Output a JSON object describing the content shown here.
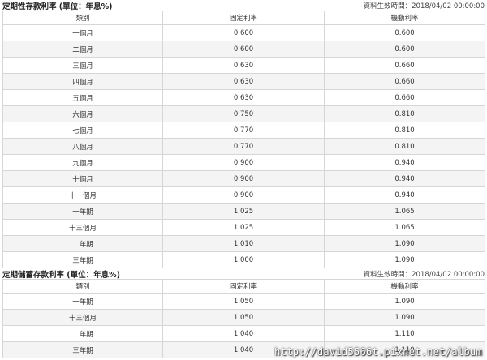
{
  "fixed_deposit": {
    "title": "定期性存款利率 (單位：年息%)",
    "effective_time": "資料生效時間：2018/04/02 00:00:00",
    "headers": [
      "類別",
      "固定利率",
      "機動利率"
    ],
    "rows": [
      [
        "一個月",
        "0.600",
        "0.600"
      ],
      [
        "二個月",
        "0.600",
        "0.600"
      ],
      [
        "三個月",
        "0.630",
        "0.660"
      ],
      [
        "四個月",
        "0.630",
        "0.660"
      ],
      [
        "五個月",
        "0.630",
        "0.660"
      ],
      [
        "六個月",
        "0.750",
        "0.810"
      ],
      [
        "七個月",
        "0.770",
        "0.810"
      ],
      [
        "八個月",
        "0.770",
        "0.810"
      ],
      [
        "九個月",
        "0.900",
        "0.940"
      ],
      [
        "十個月",
        "0.900",
        "0.940"
      ],
      [
        "十一個月",
        "0.900",
        "0.940"
      ],
      [
        "一年期",
        "1.025",
        "1.065"
      ],
      [
        "十三個月",
        "1.025",
        "1.065"
      ],
      [
        "二年期",
        "1.010",
        "1.090"
      ],
      [
        "三年期",
        "1.000",
        "1.090"
      ]
    ]
  },
  "savings_deposit": {
    "title": "定期儲蓄存款利率 (單位：年息%)",
    "effective_time": "資料生效時間：2018/04/02 00:00:00",
    "headers": [
      "類別",
      "固定利率",
      "機動利率"
    ],
    "rows": [
      [
        "一年期",
        "1.050",
        "1.090"
      ],
      [
        "十三個月",
        "1.050",
        "1.090"
      ],
      [
        "二年期",
        "1.040",
        "1.110"
      ],
      [
        "三年期",
        "1.040",
        "1.110"
      ]
    ]
  },
  "watermark": "http://david5566t.pixnet.net/album"
}
